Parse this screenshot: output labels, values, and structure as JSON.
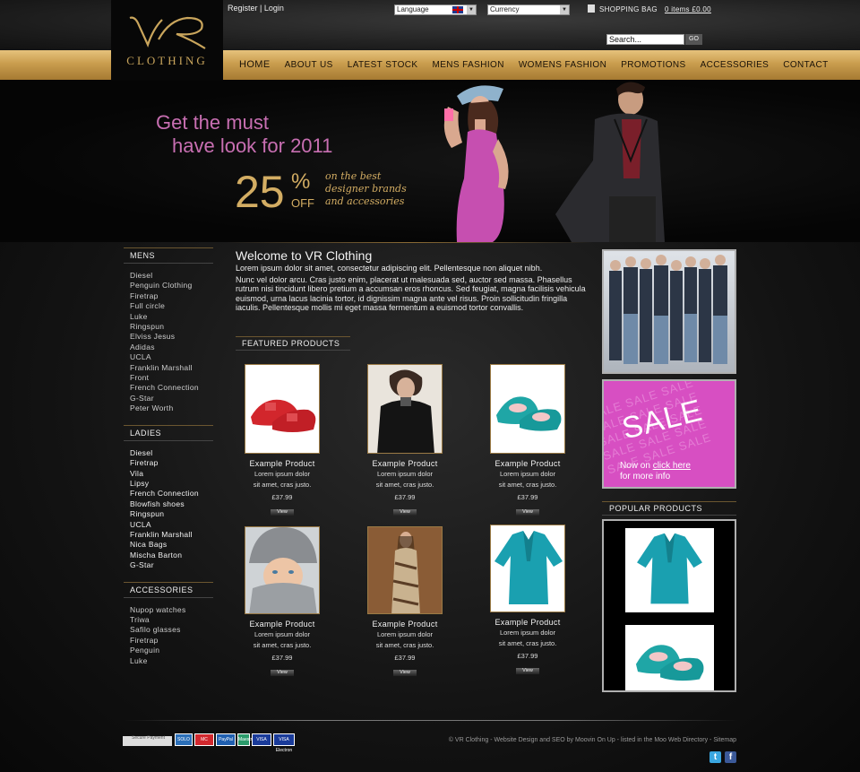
{
  "header": {
    "logo_mark": "VR",
    "logo_text": "CLOTHING",
    "account_link": "Register | Login",
    "language_label": "Language",
    "currency_label": "Currency",
    "shopping_bag_label": "SHOPPING BAG",
    "bag_items": "0 items £0.00",
    "search_value": "Search...",
    "search_button": "GO"
  },
  "nav": {
    "items": [
      "HOME",
      "ABOUT US",
      "LATEST STOCK",
      "MENS FASHION",
      "WOMENS FASHION",
      "PROMOTIONS",
      "ACCESSORIES",
      "CONTACT"
    ]
  },
  "hero": {
    "line1": "Get the must",
    "line2": "have look for 2011",
    "discount": "25",
    "percent_sign": "%",
    "off": "OFF",
    "tagline": "on the best designer brands and accessories"
  },
  "sidebar": {
    "mens_title": "MENS",
    "mens": [
      "Diesel",
      "Penguin Clothing",
      "Firetrap",
      "Full circle",
      "Luke",
      "Ringspun",
      "Elviss Jesus",
      "Adidas",
      "UCLA",
      "Franklin Marshall",
      "Front",
      "French Connection",
      "G-Star",
      "Peter Worth"
    ],
    "ladies_title": "LADIES",
    "ladies": [
      "Diesel",
      "Firetrap",
      "Vila",
      "Lipsy",
      "French Connection",
      "Blowfish shoes",
      "Ringspun",
      "UCLA",
      "Franklin Marshall",
      "Nica Bags",
      "Mischa Barton",
      "G-Star"
    ],
    "accessories_title": "ACCESSORIES",
    "accessories": [
      "Nupop watches",
      "Triwa",
      "Safilo glasses",
      "Firetrap",
      "Penguin",
      "Luke"
    ]
  },
  "main": {
    "welcome_title": "Welcome to VR Clothing",
    "intro_line": "Lorem ipsum dolor sit amet, consectetur adipiscing elit. Pellentesque non aliquet nibh.",
    "intro_body": "Nunc vel dolor arcu. Cras justo enim, placerat ut malesuada sed, auctor sed massa. Phasellus rutrum nisi tincidunt libero pretium a accumsan eros rhoncus. Sed feugiat, magna facilisis vehicula euismod, urna lacus lacinia tortor, id dignissim magna ante vel risus. Proin sollicitudin fringilla iaculis. Pellentesque mollis mi eget massa fermentum a euismod tortor convallis.",
    "featured_title": "FEATURED PRODUCTS",
    "products": [
      {
        "name": "Example Product",
        "desc1": "Lorem ipsum dolor",
        "desc2": "sit amet, cras justo.",
        "price": "£37.99",
        "button": "View",
        "image": "red-shoes"
      },
      {
        "name": "Example Product",
        "desc1": "Lorem ipsum dolor",
        "desc2": "sit amet, cras justo.",
        "price": "£37.99",
        "button": "View",
        "image": "man-black-coat"
      },
      {
        "name": "Example Product",
        "desc1": "Lorem ipsum dolor",
        "desc2": "sit amet, cras justo.",
        "price": "£37.99",
        "button": "View",
        "image": "teal-shoes"
      },
      {
        "name": "Example Product",
        "desc1": "Lorem ipsum dolor",
        "desc2": "sit amet, cras justo.",
        "price": "£37.99",
        "button": "View",
        "image": "woman-grey-hat"
      },
      {
        "name": "Example Product",
        "desc1": "Lorem ipsum dolor",
        "desc2": "sit amet, cras justo.",
        "price": "£37.99",
        "button": "View",
        "image": "woman-print-dress"
      },
      {
        "name": "Example Product",
        "desc1": "Lorem ipsum dolor",
        "desc2": "sit amet, cras justo.",
        "price": "£37.99",
        "button": "View",
        "image": "teal-blouse"
      }
    ]
  },
  "right": {
    "sale_pattern": "SALE SALE SALE",
    "sale_word": "SALE",
    "sale_now": "Now on",
    "sale_link": "click here",
    "sale_more": "for more info",
    "popular_title": "POPULAR PRODUCTS"
  },
  "footer": {
    "secure_label": "Secure Payment",
    "card_logos": [
      "SOLO",
      "MC",
      "PayPal",
      "Maestro",
      "VISA",
      "VISA Electron"
    ],
    "copyright": "© VR Clothing - Website Design and SEO by Moovin On Up - listed in the Moo Web Directory - Sitemap",
    "social_twitter": "t",
    "social_facebook": "f"
  },
  "colors": {
    "gold": "#c99d4e",
    "pink": "#c86fb2",
    "sale_pink": "#d74fc2",
    "teal": "#1fa6a6"
  }
}
